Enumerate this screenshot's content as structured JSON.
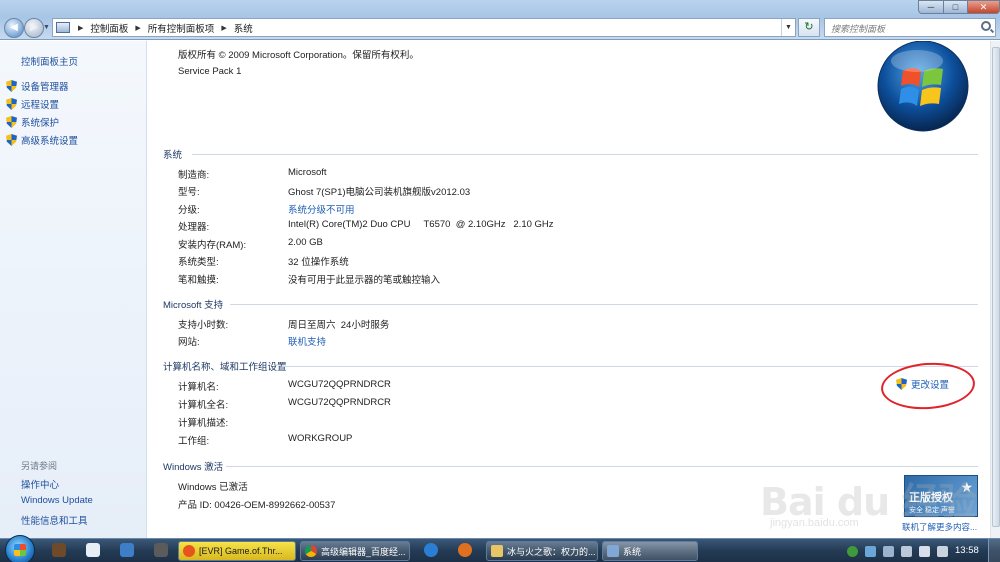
{
  "window": {
    "breadcrumbs": [
      "控制面板",
      "所有控制面板项",
      "系统"
    ],
    "search_placeholder": "搜索控制面板",
    "controls": {
      "minimize": "─",
      "maximize": "□",
      "close": "✕"
    }
  },
  "sidebar": {
    "home": "控制面板主页",
    "items": [
      "设备管理器",
      "远程设置",
      "系统保护",
      "高级系统设置"
    ],
    "see_also_title": "另请参阅",
    "see_also": [
      "操作中心",
      "Windows Update",
      "性能信息和工具"
    ]
  },
  "edition": {
    "copyright": "版权所有 © 2009 Microsoft Corporation。保留所有权利。",
    "service_pack": "Service Pack 1"
  },
  "system": {
    "title": "系统",
    "rows": [
      {
        "label": "制造商:",
        "value": "Microsoft"
      },
      {
        "label": "型号:",
        "value": "Ghost 7(SP1)电脑公司装机旗舰版v2012.03"
      },
      {
        "label": "分级:",
        "value": "系统分级不可用"
      },
      {
        "label": "处理器:",
        "value": "Intel(R) Core(TM)2 Duo CPU     T6570  @ 2.10GHz   2.10 GHz"
      },
      {
        "label": "安装内存(RAM):",
        "value": "2.00 GB"
      },
      {
        "label": "系统类型:",
        "value": "32 位操作系统"
      },
      {
        "label": "笔和触摸:",
        "value": "没有可用于此显示器的笔或触控输入"
      }
    ]
  },
  "support": {
    "title": "Microsoft 支持",
    "rows": [
      {
        "label": "支持小时数:",
        "value": "周日至周六  24小时服务"
      },
      {
        "label": "网站:",
        "value": "联机支持"
      }
    ]
  },
  "computer": {
    "title": "计算机名称、域和工作组设置",
    "change_settings": "更改设置",
    "rows": [
      {
        "label": "计算机名:",
        "value": "WCGU72QQPRNDRCR"
      },
      {
        "label": "计算机全名:",
        "value": "WCGU72QQPRNDRCR"
      },
      {
        "label": "计算机描述:",
        "value": ""
      },
      {
        "label": "工作组:",
        "value": "WORKGROUP"
      }
    ]
  },
  "activation": {
    "title": "Windows 激活",
    "status": "Windows 已激活",
    "product_id": "产品 ID: 00426-OEM-8992662-00537",
    "badge_line1": "正版授权",
    "badge_line2": "安全 稳定 声誉",
    "more": "联机了解更多内容..."
  },
  "watermark": {
    "text": "Bai du 经验",
    "sub": "jingyan.baidu.com"
  },
  "taskbar": {
    "items": [
      "[EVR] Game.of.Thr...",
      "高级编辑器_百度经...",
      "冰与火之歌：权力的...",
      "系统"
    ],
    "clock": "13:58"
  },
  "colors": {
    "link": "#1e5fb5",
    "annotation": "#e0242b",
    "taskbar": "#243b55"
  }
}
